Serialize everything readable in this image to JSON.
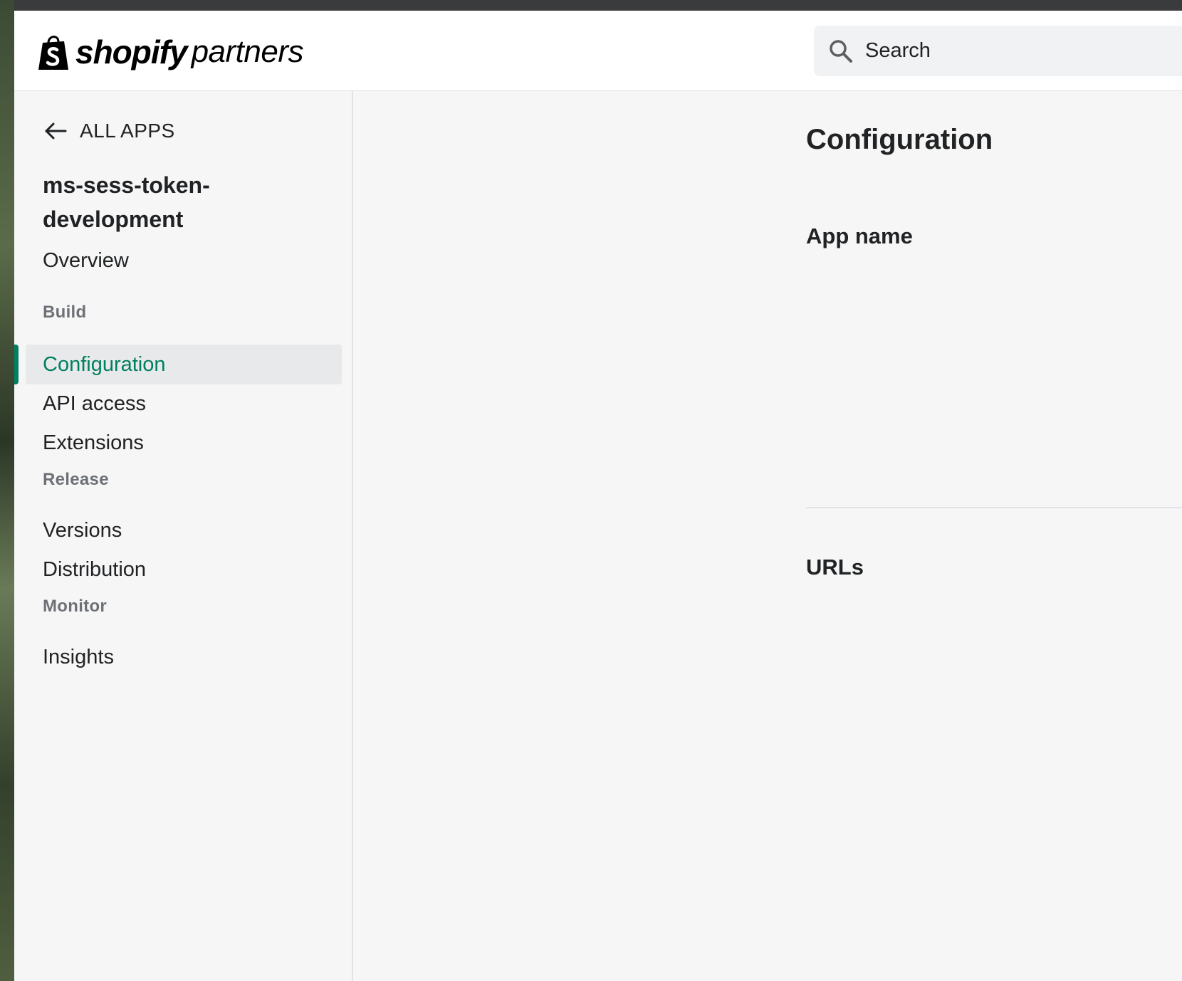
{
  "brand": {
    "word1": "shopify",
    "word2": "partners"
  },
  "search": {
    "placeholder": "Search"
  },
  "sidebar": {
    "back_label": "ALL APPS",
    "app_name": "ms-sess-token-development",
    "overview": "Overview",
    "sections": {
      "build": "Build",
      "release": "Release",
      "monitor": "Monitor"
    },
    "build_items": [
      "Configuration",
      "API access",
      "Extensions"
    ],
    "release_items": [
      "Versions",
      "Distribution"
    ],
    "monitor_items": [
      "Insights"
    ],
    "active_item": "Configuration"
  },
  "main": {
    "page_title": "Configuration",
    "sections": [
      "App name",
      "URLs"
    ]
  },
  "colors": {
    "accent": "#008060",
    "text": "#202223",
    "muted": "#6d7175",
    "background": "#f6f6f7"
  }
}
